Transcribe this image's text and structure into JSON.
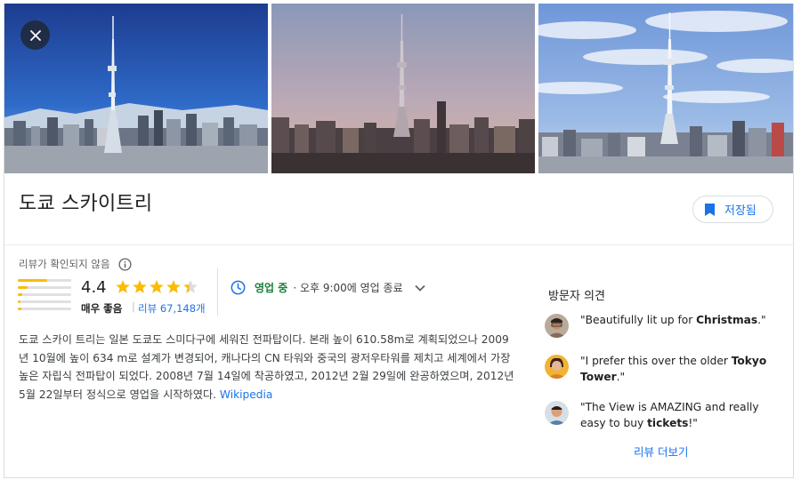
{
  "place": {
    "title": "도쿄 스카이트리",
    "save_label": "저장됨"
  },
  "photos": [
    {
      "name": "tokyo-skytree-daytime-photo"
    },
    {
      "name": "tokyo-skytree-dusk-photo"
    },
    {
      "name": "tokyo-skytree-cloudy-photo"
    }
  ],
  "rating": {
    "unverified_label": "리뷰가 확인되지 않음",
    "score": "4.4",
    "stars_value": 4.4,
    "stars_max": 5,
    "label": "매우 좋음",
    "separator": "|",
    "reviews_link": "리뷰 67,148개",
    "distribution": [
      0.55,
      0.18,
      0.08,
      0.05,
      0.07
    ],
    "star_color": "#fbbc04"
  },
  "hours": {
    "status": "영업 중",
    "detail": "· 오후 9:00에 영업 종료",
    "status_color": "#188038"
  },
  "description": {
    "text": "도쿄 스카이 트리는 일본 도쿄도 스미다구에 세워진 전파탑이다. 본래 높이 610.58m로 계획되었으나 2009년 10월에 높이 634 m로 설계가 변경되어, 캐나다의 CN 타워와 중국의 광저우타워를 제치고 세계에서 가장 높은 자립식 전파탑이 되었다. 2008년 7월 14일에 착공하였고, 2012년 2월 29일에 완공하였으며, 2012년 5월 22일부터 정식으로 영업을 시작하였다.",
    "source": "Wikipedia"
  },
  "visitors": {
    "title": "방문자 의견",
    "opinions": [
      {
        "pre": "\"Beautifully lit up for ",
        "bold": "Christmas",
        "post": ".\""
      },
      {
        "pre": "\"I prefer this over the older ",
        "bold": "Tokyo Tower",
        "post": ".\""
      },
      {
        "pre": "\"The View is AMAZING and really easy to buy ",
        "bold": "tickets",
        "post": "!\""
      }
    ],
    "more_label": "리뷰 더보기"
  },
  "colors": {
    "accent": "#1a73e8",
    "text": "#202124",
    "muted": "#5f6368"
  }
}
